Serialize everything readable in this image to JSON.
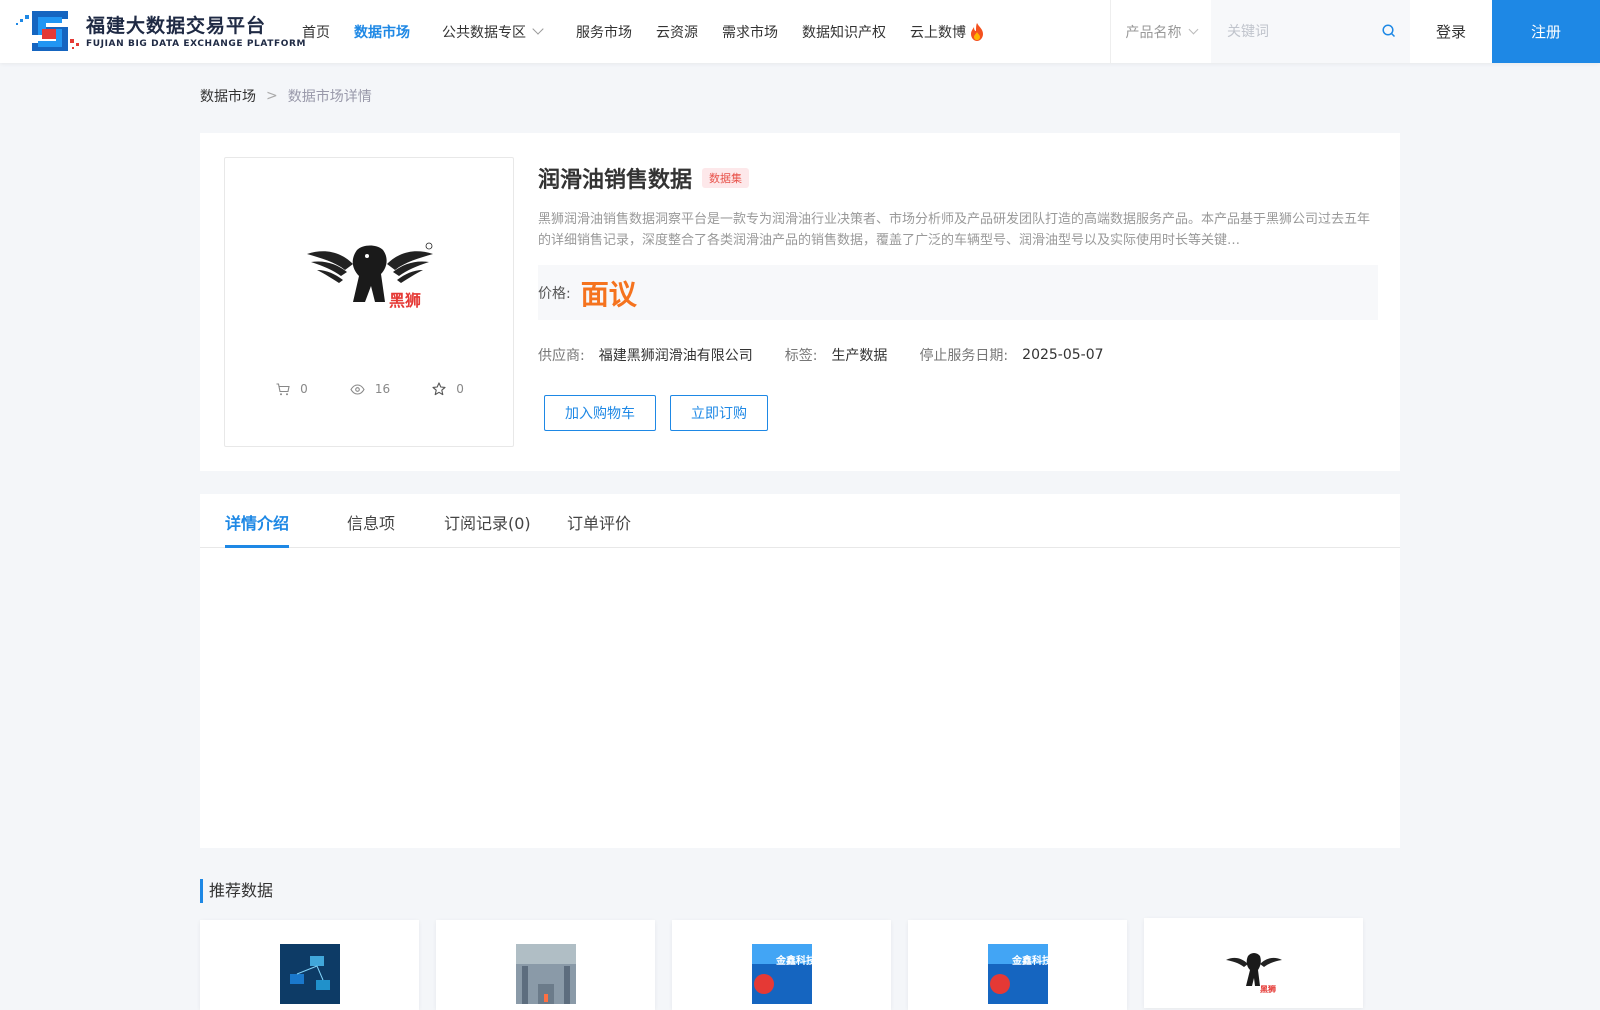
{
  "header": {
    "logo_cn": "福建大数据交易平台",
    "logo_en": "FUJIAN BIG DATA EXCHANGE  PLATFORM",
    "nav": [
      {
        "label": "首页",
        "active": false
      },
      {
        "label": "数据市场",
        "active": true
      },
      {
        "label": "公共数据专区",
        "active": false,
        "dropdown": true
      },
      {
        "label": "服务市场",
        "active": false
      },
      {
        "label": "云资源",
        "active": false
      },
      {
        "label": "需求市场",
        "active": false
      },
      {
        "label": "数据知识产权",
        "active": false
      },
      {
        "label": "云上数博",
        "active": false,
        "hot": true
      }
    ],
    "search_category": "产品名称",
    "search_placeholder": "关键词",
    "login": "登录",
    "register": "注册"
  },
  "breadcrumb": {
    "level1": "数据市场",
    "separator": ">",
    "level2": "数据市场详情"
  },
  "product": {
    "title": "润滑油销售数据",
    "type_badge": "数据集",
    "description": "黑狮润滑油销售数据洞察平台是一款专为润滑油行业决策者、市场分析师及产品研发团队打造的高端数据服务产品。本产品基于黑狮公司过去五年的详细销售记录，深度整合了各类润滑油产品的销售数据，覆盖了广泛的车辆型号、润滑油型号以及实际使用时长等关键…",
    "price_label": "价格:",
    "price_value": "面议",
    "supplier_label": "供应商:",
    "supplier_value": "福建黑狮润滑油有限公司",
    "tag_label": "标签:",
    "tag_value": "生产数据",
    "stop_date_label": "停止服务日期:",
    "stop_date_value": "2025-05-07",
    "cart_count": "0",
    "view_count": "16",
    "fav_count": "0",
    "add_cart_btn": "加入购物车",
    "subscribe_btn": "立即订购",
    "brand_text": "黑狮"
  },
  "tabs": [
    {
      "label": "详情介绍",
      "active": true
    },
    {
      "label": "信息项",
      "active": false
    },
    {
      "label": "订阅记录(0)",
      "active": false
    },
    {
      "label": "订单评价",
      "active": false
    }
  ],
  "recommend": {
    "title": "推荐数据",
    "items_brand": [
      "金鑫科技",
      "金鑫科技",
      "黑狮"
    ]
  },
  "colors": {
    "accent": "#1e88e5",
    "price": "#f5731e",
    "badge_bg": "#fde8ea",
    "badge_text": "#e8534b"
  }
}
